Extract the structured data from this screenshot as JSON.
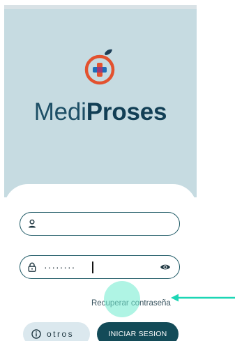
{
  "app": {
    "brand_light": "Medi",
    "brand_bold": "Proses"
  },
  "form": {
    "username_value": "",
    "password_value": "········"
  },
  "links": {
    "recover_password": "Recuperar contraseña"
  },
  "buttons": {
    "others": "otros",
    "login": "INICIAR SESION"
  },
  "icons": {
    "logo": "apple-medical-cross-icon",
    "user": "user-icon",
    "lock": "lock-icon",
    "eye": "eye-icon",
    "info": "info-icon"
  },
  "colors": {
    "hero_background": "#c6dbe1",
    "brand_text": "#1d4f66",
    "primary_button": "#134b58",
    "secondary_button": "#dbe8ee",
    "field_border": "#1f5a66",
    "logo_red": "#e3522f",
    "logo_blue": "#1e6fb8",
    "tap_highlight": "#6eebcd"
  }
}
